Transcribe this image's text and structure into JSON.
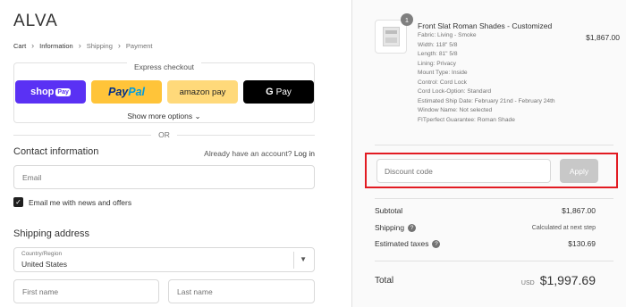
{
  "brand": "ALVA",
  "breadcrumbs": [
    {
      "label": "Cart"
    },
    {
      "label": "Information"
    },
    {
      "label": "Shipping"
    },
    {
      "label": "Payment"
    }
  ],
  "express": {
    "title": "Express checkout",
    "shop_label": "shop",
    "shop_tag": "Pay",
    "paypal_part1": "Pay",
    "paypal_part2": "Pal",
    "amazon_label": "amazon pay",
    "gpay_g": "G",
    "gpay_label": "Pay",
    "show_more": "Show more options"
  },
  "or_text": "OR",
  "contact": {
    "title": "Contact information",
    "account_prefix": "Already have an account?",
    "login_link": "Log in",
    "email_placeholder": "Email",
    "newsletter_label": "Email me with news and offers",
    "newsletter_checked": true
  },
  "shipping": {
    "title": "Shipping address",
    "country_label": "Country/Region",
    "country_value": "United States",
    "first_name_placeholder": "First name",
    "last_name_placeholder": "Last name"
  },
  "order": {
    "quantity": "1",
    "product_title": "Front Slat Roman Shades - Customized",
    "product_price": "$1,867.00",
    "details": [
      "Fabric: Living - Smoke",
      "Width: 118\" 5/8",
      "Length: 81\" 5/8",
      "Lining: Privacy",
      "Mount Type: Inside",
      "Control: Cord Lock",
      "Cord Lock-Option: Standard",
      "Estimated Ship Date: February 21nd - February 24th",
      "Window Name: Not selected",
      "FITperfect Guarantee: Roman Shade"
    ],
    "discount_placeholder": "Discount code",
    "apply_label": "Apply",
    "subtotal_label": "Subtotal",
    "subtotal_value": "$1,867.00",
    "shipping_label": "Shipping",
    "shipping_value": "Calculated at next step",
    "taxes_label": "Estimated taxes",
    "taxes_value": "$130.69",
    "total_label": "Total",
    "total_currency": "USD",
    "total_value": "$1,997.69"
  },
  "colors": {
    "shop_pay": "#5a31f4",
    "paypal": "#ffc439",
    "amazon_pay": "#ffd97a",
    "google_pay": "#000000",
    "highlight": "#e21b22"
  }
}
